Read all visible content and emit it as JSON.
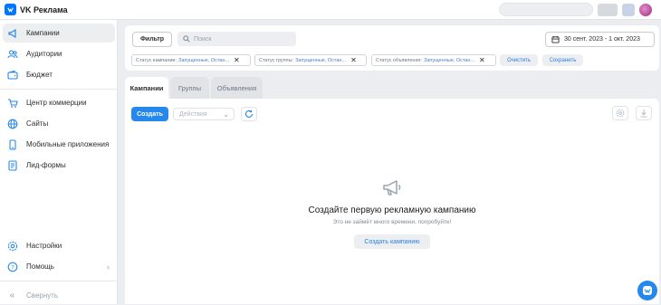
{
  "header": {
    "brand": "VK Реклама",
    "colors": {
      "accent": "#0077ff"
    }
  },
  "sidebar": {
    "items": [
      {
        "label": "Кампании",
        "icon": "megaphone-icon",
        "active": true
      },
      {
        "label": "Аудитории",
        "icon": "users-icon"
      },
      {
        "label": "Бюджет",
        "icon": "wallet-icon"
      },
      {
        "label": "Центр коммерции",
        "icon": "cart-icon"
      },
      {
        "label": "Сайты",
        "icon": "globe-icon"
      },
      {
        "label": "Мобильные приложения",
        "icon": "smartphone-icon"
      },
      {
        "label": "Лид-формы",
        "icon": "form-icon"
      }
    ],
    "settings_label": "Настройки",
    "help_label": "Помощь",
    "collapse_label": "Свернуть"
  },
  "filterbar": {
    "filter_label": "Фильтр",
    "search_placeholder": "Поиск",
    "date_range": "30 сент. 2023 - 1 окт. 2023",
    "chips": [
      {
        "label": "Статус кампании:",
        "value": "Запущенные, Остан..."
      },
      {
        "label": "Статус группы:",
        "value": "Запущенные, Остан..."
      },
      {
        "label": "Статус объявления:",
        "value": "Запущенные, Остан..."
      }
    ],
    "clear_label": "Очистить",
    "save_label": "Сохранить"
  },
  "tabs": [
    {
      "label": "Кампании",
      "active": true
    },
    {
      "label": "Группы"
    },
    {
      "label": "Объявления"
    }
  ],
  "toolbar": {
    "create_label": "Создать",
    "actions_placeholder": "Действия"
  },
  "empty_state": {
    "title": "Создайте первую рекламную кампанию",
    "subtitle": "Это не займёт много времени, попробуйте!",
    "cta_label": "Создать кампанию"
  }
}
